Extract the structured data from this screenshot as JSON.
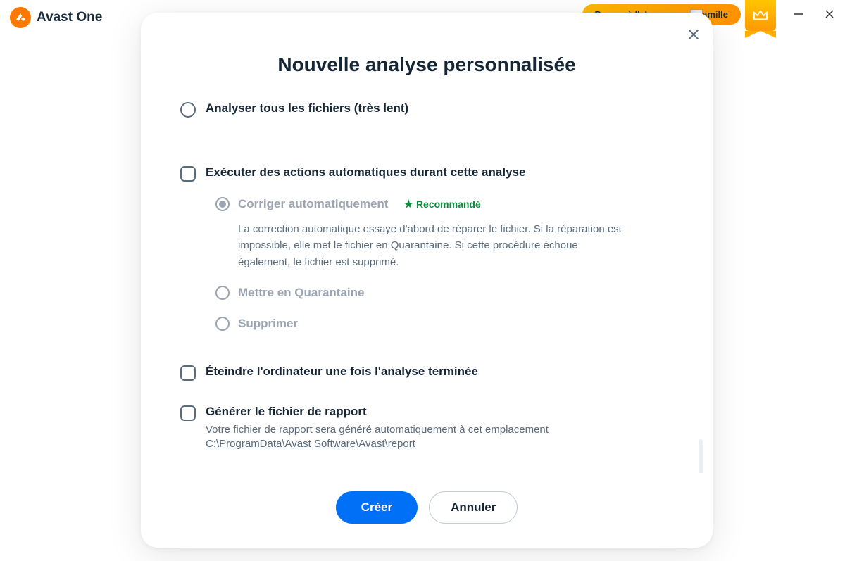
{
  "app": {
    "name": "Avast One"
  },
  "header": {
    "family_label": "Passer à l'abonnement Famille"
  },
  "modal": {
    "title": "Nouvelle analyse personnalisée",
    "options": {
      "scan_all": "Analyser tous les fichiers (très lent)",
      "auto_actions": "Exécuter des actions automatiques durant cette analyse",
      "shutdown": "Éteindre l'ordinateur une fois l'analyse terminée",
      "report": "Générer le fichier de rapport",
      "report_desc": "Votre fichier de rapport sera généré automatiquement à cet emplacement",
      "report_path": "C:\\ProgramData\\Avast Software\\Avast\\report"
    },
    "radios": {
      "fix": "Corriger automatiquement",
      "fix_reco": "Recommandé",
      "fix_desc": "La correction automatique essaye d'abord de réparer le fichier. Si la réparation est impossible, elle met le fichier en Quarantaine. Si cette procédure échoue également, le fichier est supprimé.",
      "quarantine": "Mettre en Quarantaine",
      "delete": "Supprimer"
    },
    "buttons": {
      "create": "Créer",
      "cancel": "Annuler"
    }
  }
}
